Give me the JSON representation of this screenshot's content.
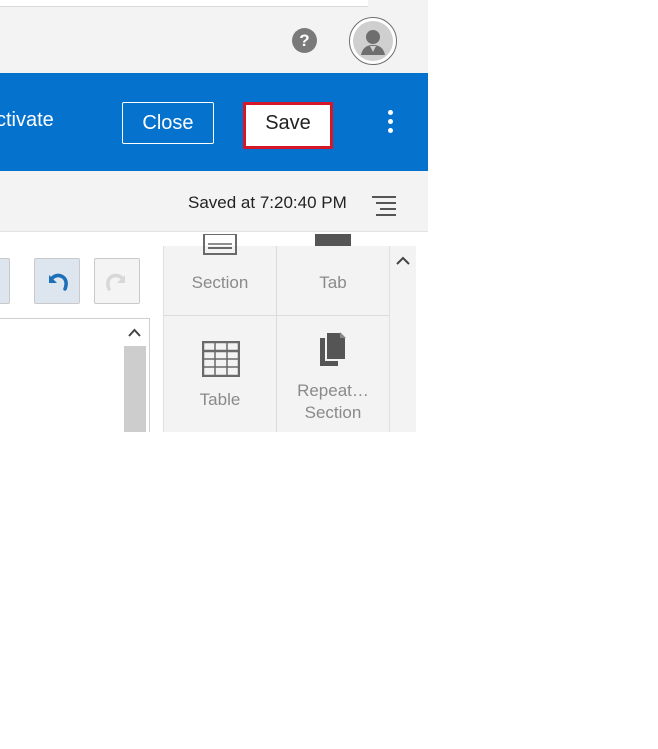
{
  "header": {
    "help_icon": "question-circle-icon",
    "help_glyph": "?",
    "avatar_icon": "user-avatar-icon"
  },
  "actionbar": {
    "activate_label": "ctivate",
    "close_label": "Close",
    "save_label": "Save",
    "more_icon": "vertical-ellipsis-icon",
    "background_color": "#0572ce",
    "highlight_color": "#d6172a"
  },
  "status": {
    "saved_text": "Saved at 7:20:40 PM",
    "menu_icon": "lines-menu-icon"
  },
  "toolbar": {
    "undo_icon": "undo-icon",
    "redo_icon": "redo-icon"
  },
  "palette": {
    "items": [
      {
        "label": "Section",
        "icon": "section-icon"
      },
      {
        "label": "Tab",
        "icon": "tab-icon"
      },
      {
        "label": "Table",
        "icon": "table-icon"
      },
      {
        "label": "Repeat…",
        "label2": "Section",
        "icon": "repeatable-section-icon"
      }
    ]
  }
}
